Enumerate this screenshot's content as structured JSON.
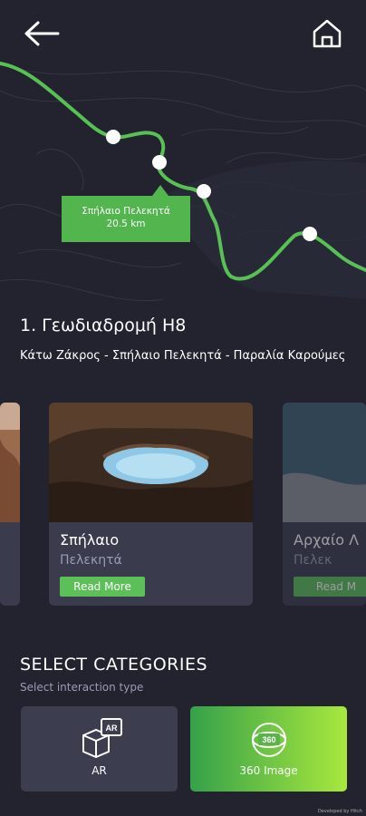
{
  "map": {
    "label_name": "Σπήλαιο Πελεκητά",
    "label_distance": "20.5 km"
  },
  "route": {
    "title": "1. Γεωδιαδρομή Η8",
    "subtitle": "Κάτω Ζάκρος - Σπήλαιο Πελεκητά - Παραλία Καρούμες"
  },
  "cards": [
    {
      "title": "Σπήλαιο",
      "subtitle": "Πελεκητά",
      "button": "Read More"
    },
    {
      "title": "Αρχαίο Λ",
      "subtitle": "Πελεκ",
      "button": "Read M"
    }
  ],
  "categories": {
    "title": "SELECT CATEGORIES",
    "subtitle": "Select interaction type",
    "ar_label": "AR",
    "ar_icon_text": "AR",
    "img360_label": "360 Image",
    "img360_icon_text": "360"
  },
  "watermark": "Developed by Hitch",
  "colors": {
    "background": "#22232f",
    "accent_green": "#53b54e",
    "card": "#3a3b4d"
  }
}
